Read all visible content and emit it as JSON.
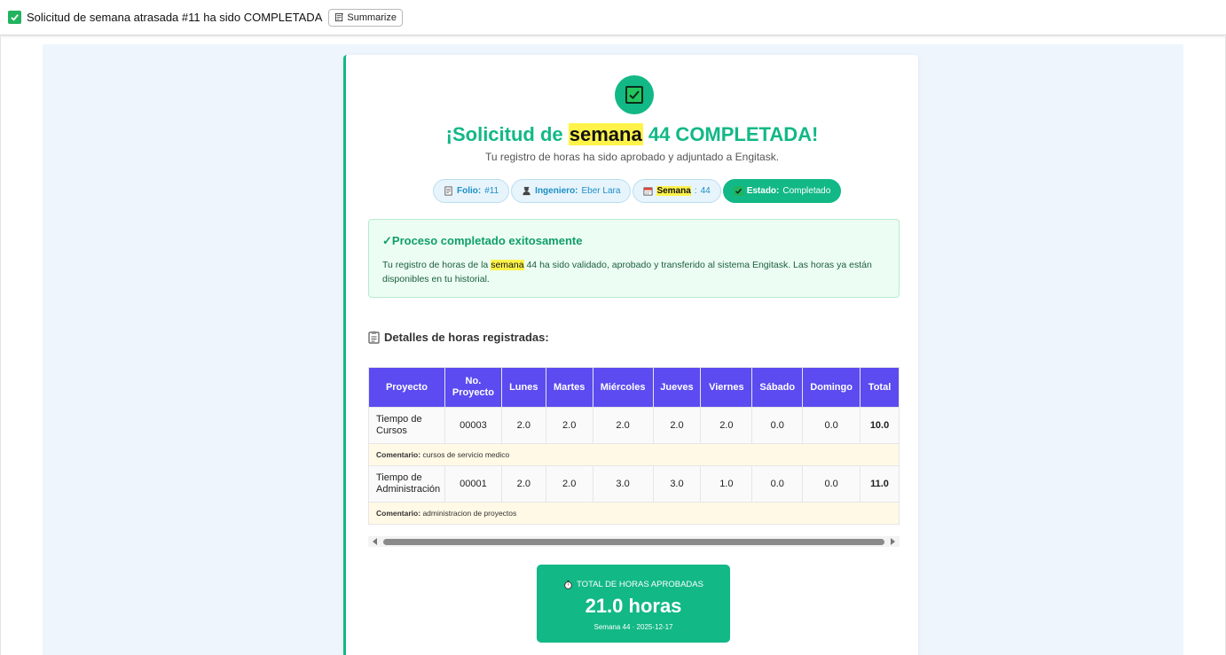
{
  "header": {
    "subject": "Solicitud de semana atrasada #11 ha sido COMPLETADA",
    "summarize_label": "Summarize"
  },
  "card": {
    "title_prefix": "¡Solicitud de",
    "title_highlight": "semana",
    "title_suffix": "44 COMPLETADA!",
    "subtitle": "Tu registro de horas ha sido aprobado y adjuntado a Engitask.",
    "pills": {
      "folio_label": "Folio:",
      "folio_value": "#11",
      "engineer_label": "Ingeniero:",
      "engineer_value": "Eber Lara",
      "week_label": "Semana",
      "week_value": "44",
      "status_label": "Estado:",
      "status_value": "Completado"
    },
    "success": {
      "title": "✓Proceso completado exitosamente",
      "text_prefix": "Tu registro de horas de la",
      "text_highlight": "semana",
      "text_suffix": "44 ha sido validado, aprobado y transferido al sistema Engitask. Las horas ya están disponibles en tu historial."
    },
    "section_title": "Detalles de horas registradas:",
    "table": {
      "headers": [
        "Proyecto",
        "No. Proyecto",
        "Lunes",
        "Martes",
        "Miércoles",
        "Jueves",
        "Viernes",
        "Sábado",
        "Domingo",
        "Total"
      ],
      "rows": [
        {
          "project": "Tiempo de Cursos",
          "number": "00003",
          "days": [
            "2.0",
            "2.0",
            "2.0",
            "2.0",
            "2.0",
            "0.0",
            "0.0"
          ],
          "total": "10.0",
          "comment_label": "Comentario:",
          "comment": "cursos de servicio medico"
        },
        {
          "project": "Tiempo de Administración",
          "number": "00001",
          "days": [
            "2.0",
            "2.0",
            "3.0",
            "3.0",
            "1.0",
            "0.0",
            "0.0"
          ],
          "total": "11.0",
          "comment_label": "Comentario:",
          "comment": "administracion de proyectos"
        }
      ]
    },
    "total": {
      "label": "TOTAL DE HORAS APROBADAS",
      "value": "21.0 horas",
      "meta": "Semana 44 · 2025-12-17"
    }
  },
  "colors": {
    "accent_green": "#12b886",
    "table_header": "#5b4bf0",
    "highlight": "#fff34a",
    "pill_blue": "#1b8fc7"
  }
}
